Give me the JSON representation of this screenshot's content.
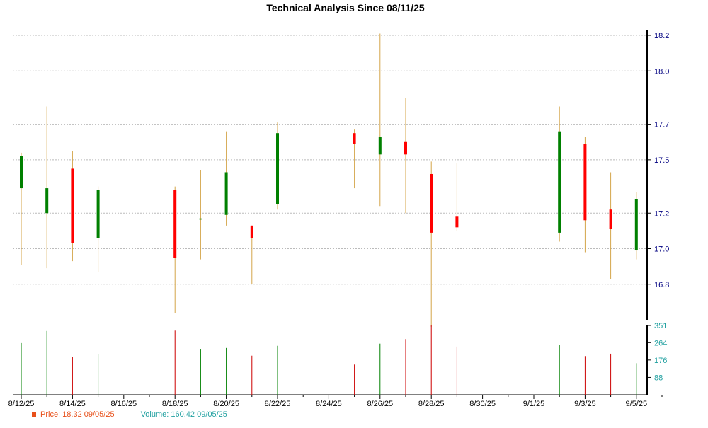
{
  "chart_data": {
    "type": "candlestick",
    "title": "Technical Analysis Since 08/11/25",
    "price_axis": {
      "ticks": [
        16.8,
        17.0,
        17.2,
        17.5,
        17.7,
        18.0,
        18.2
      ],
      "ylim": [
        16.6,
        18.2
      ]
    },
    "volume_axis": {
      "ticks": [
        88,
        176,
        264,
        351
      ],
      "ylim": [
        0,
        351
      ]
    },
    "x_ticks": [
      "8/12/25",
      "8/14/25",
      "8/16/25",
      "8/18/25",
      "8/20/25",
      "8/22/25",
      "8/24/25",
      "8/26/25",
      "8/28/25",
      "8/30/25",
      "9/1/25",
      "9/3/25",
      "9/5/25"
    ],
    "colors": {
      "up": "#008000",
      "down": "#ff0000",
      "wick": "#d4a54a",
      "vol_up": "#008000",
      "vol_down": "#cc0000",
      "grid": "#bbbbbb",
      "axis_text": "#000080",
      "vol_text": "#20a0a0"
    },
    "candles": [
      {
        "date": "8/12/25",
        "day": 1,
        "open": 17.34,
        "close": 17.52,
        "high": 17.54,
        "low": 16.91,
        "volume": 262
      },
      {
        "date": "8/13/25",
        "day": 2,
        "open": 17.2,
        "close": 17.34,
        "high": 17.8,
        "low": 16.89,
        "volume": 323
      },
      {
        "date": "8/14/25",
        "day": 3,
        "open": 17.45,
        "close": 17.03,
        "high": 17.55,
        "low": 16.93,
        "volume": 192
      },
      {
        "date": "8/15/25",
        "day": 4,
        "open": 17.06,
        "close": 17.33,
        "high": 17.35,
        "low": 16.87,
        "volume": 208
      },
      {
        "date": "8/18/25",
        "day": 7,
        "open": 17.33,
        "close": 16.95,
        "high": 17.35,
        "low": 16.64,
        "volume": 325
      },
      {
        "date": "8/19/25",
        "day": 8,
        "open": 17.17,
        "close": 17.17,
        "high": 17.44,
        "low": 16.94,
        "volume": 229
      },
      {
        "date": "8/20/25",
        "day": 9,
        "open": 17.19,
        "close": 17.43,
        "high": 17.66,
        "low": 17.13,
        "volume": 237
      },
      {
        "date": "8/21/25",
        "day": 10,
        "open": 17.13,
        "close": 17.06,
        "high": 17.13,
        "low": 16.8,
        "volume": 198
      },
      {
        "date": "8/22/25",
        "day": 11,
        "open": 17.25,
        "close": 17.65,
        "high": 17.71,
        "low": 17.22,
        "volume": 248
      },
      {
        "date": "8/25/25",
        "day": 14,
        "open": 17.65,
        "close": 17.59,
        "high": 17.67,
        "low": 17.34,
        "volume": 153
      },
      {
        "date": "8/26/25",
        "day": 15,
        "open": 17.53,
        "close": 17.63,
        "high": 18.21,
        "low": 17.24,
        "volume": 259
      },
      {
        "date": "8/27/25",
        "day": 16,
        "open": 17.6,
        "close": 17.53,
        "high": 17.85,
        "low": 17.2,
        "volume": 282
      },
      {
        "date": "8/28/25",
        "day": 17,
        "open": 17.42,
        "close": 17.09,
        "high": 17.49,
        "low": 16.56,
        "volume": 351
      },
      {
        "date": "8/29/25",
        "day": 18,
        "open": 17.18,
        "close": 17.12,
        "high": 17.48,
        "low": 17.1,
        "volume": 244
      },
      {
        "date": "9/2/25",
        "day": 22,
        "open": 17.09,
        "close": 17.66,
        "high": 17.8,
        "low": 17.04,
        "volume": 251
      },
      {
        "date": "9/3/25",
        "day": 23,
        "open": 17.59,
        "close": 17.16,
        "high": 17.63,
        "low": 16.98,
        "volume": 196
      },
      {
        "date": "9/4/25",
        "day": 24,
        "open": 17.22,
        "close": 17.11,
        "high": 17.43,
        "low": 16.83,
        "volume": 208
      },
      {
        "date": "9/5/25",
        "day": 25,
        "open": 16.99,
        "close": 17.28,
        "high": 17.32,
        "low": 16.94,
        "volume": 160
      }
    ],
    "legend": {
      "price_label": "Price: 18.32  09/05/25",
      "volume_label": "Volume: 160.42  09/05/25",
      "price_color": "#e8501a",
      "volume_color": "#20a0a0"
    }
  }
}
